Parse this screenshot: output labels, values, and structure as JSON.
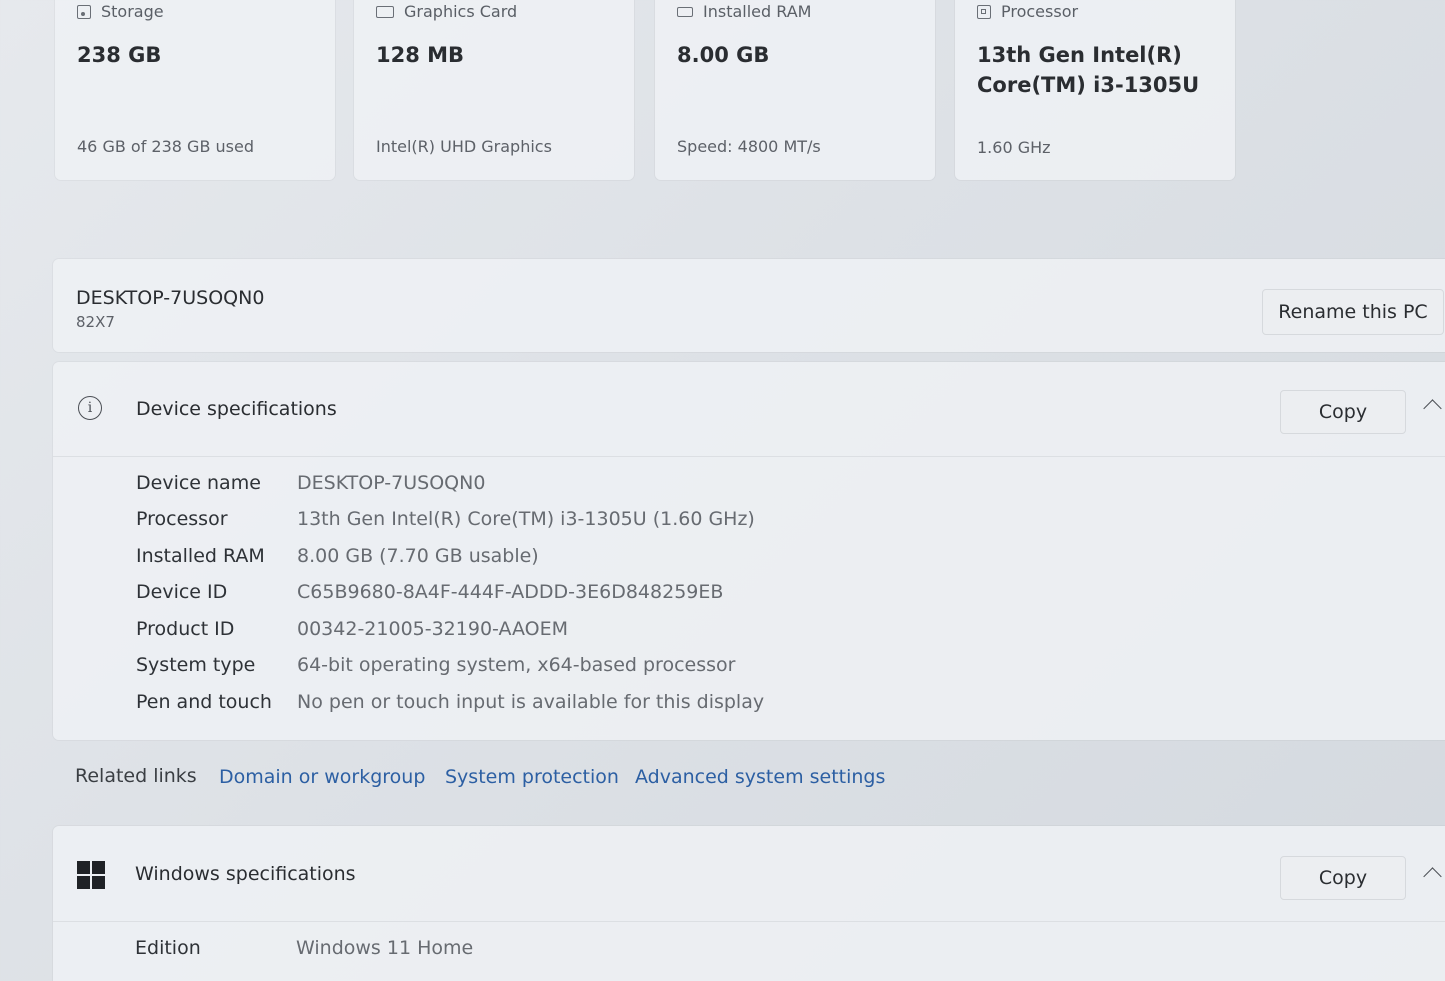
{
  "summary_cards": [
    {
      "label": "Storage",
      "icon": "storage-icon",
      "value": "238 GB",
      "sub": "46 GB of 238 GB used"
    },
    {
      "label": "Graphics Card",
      "icon": "graphics-card-icon",
      "value": "128 MB",
      "sub": "Intel(R) UHD Graphics"
    },
    {
      "label": "Installed RAM",
      "icon": "ram-icon",
      "value": "8.00 GB",
      "sub": "Speed: 4800 MT/s"
    },
    {
      "label": "Processor",
      "icon": "processor-icon",
      "value_line1": "13th Gen Intel(R)",
      "value_line2": "Core(TM) i3-1305U",
      "sub": "1.60 GHz"
    }
  ],
  "device": {
    "name": "DESKTOP-7USOQN0",
    "model": "82X7",
    "rename_label": "Rename this PC"
  },
  "device_specs": {
    "title": "Device specifications",
    "copy_label": "Copy",
    "rows": [
      {
        "label": "Device name",
        "value": "DESKTOP-7USOQN0"
      },
      {
        "label": "Processor",
        "value": "13th Gen Intel(R) Core(TM) i3-1305U (1.60 GHz)"
      },
      {
        "label": "Installed RAM",
        "value": "8.00 GB (7.70 GB usable)"
      },
      {
        "label": "Device ID",
        "value": "C65B9680-8A4F-444F-ADDD-3E6D848259EB"
      },
      {
        "label": "Product ID",
        "value": "00342-21005-32190-AAOEM"
      },
      {
        "label": "System type",
        "value": "64-bit operating system, x64-based processor"
      },
      {
        "label": "Pen and touch",
        "value": "No pen or touch input is available for this display"
      }
    ]
  },
  "related_links": {
    "label": "Related links",
    "links": [
      "Domain or workgroup",
      "System protection",
      "Advanced system settings"
    ]
  },
  "windows_specs": {
    "title": "Windows specifications",
    "copy_label": "Copy",
    "rows": [
      {
        "label": "Edition",
        "value": "Windows 11 Home"
      }
    ]
  },
  "colors": {
    "link": "#2c5fa3",
    "background": "#e2e6ea"
  }
}
